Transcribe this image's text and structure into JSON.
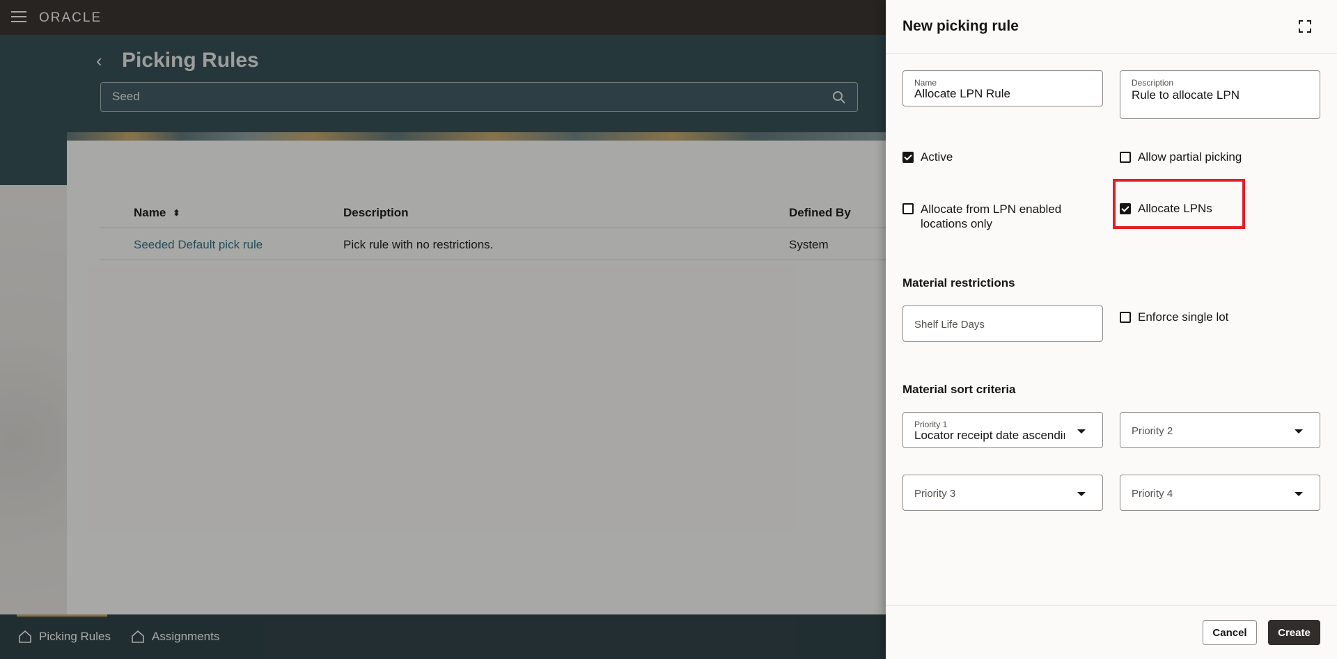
{
  "app": {
    "logo": "ORACLE"
  },
  "page": {
    "title": "Picking Rules",
    "search": {
      "value": "Seed",
      "placeholder": ""
    },
    "table": {
      "columns": [
        "Name",
        "Description",
        "Defined By"
      ],
      "rows": [
        {
          "name": "Seeded Default pick rule",
          "description": "Pick rule with no restrictions.",
          "defined_by": "System"
        }
      ]
    }
  },
  "bottom_nav": {
    "items": [
      {
        "label": "Picking Rules",
        "active": true
      },
      {
        "label": "Assignments",
        "active": false
      }
    ]
  },
  "drawer": {
    "title": "New picking rule",
    "name": {
      "label": "Name",
      "value": "Allocate LPN Rule"
    },
    "description": {
      "label": "Description",
      "value": "Rule to allocate LPN"
    },
    "checkboxes": {
      "active": {
        "label": "Active",
        "checked": true
      },
      "allow_partial": {
        "label": "Allow partial picking",
        "checked": false
      },
      "allocate_from_lpn": {
        "label": "Allocate from LPN enabled locations only",
        "checked": false
      },
      "allocate_lpns": {
        "label": "Allocate LPNs",
        "checked": true
      },
      "enforce_single_lot": {
        "label": "Enforce single lot",
        "checked": false
      }
    },
    "material_restrictions": {
      "title": "Material restrictions",
      "shelf_life_placeholder": "Shelf Life Days"
    },
    "material_sort": {
      "title": "Material sort criteria",
      "priority1": {
        "label": "Priority 1",
        "value": "Locator receipt date ascending"
      },
      "priority2": {
        "label": "Priority 2"
      },
      "priority3": {
        "label": "Priority 3"
      },
      "priority4": {
        "label": "Priority 4"
      }
    },
    "buttons": {
      "cancel": "Cancel",
      "create": "Create"
    }
  },
  "colors": {
    "topbar": "#312d2a",
    "header_band": "#2f4a52",
    "link": "#2c6e80",
    "highlight": "#e01f26",
    "primary_button": "#312d2a"
  }
}
